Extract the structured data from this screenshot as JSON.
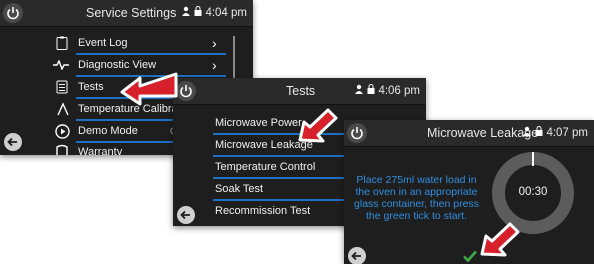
{
  "screen1": {
    "title": "Service Settings",
    "time": "4:04 pm",
    "items": [
      {
        "label": "Event Log",
        "icon": "clipboard-icon"
      },
      {
        "label": "Diagnostic View",
        "icon": "pulse-icon"
      },
      {
        "label": "Tests",
        "icon": "checklist-icon"
      },
      {
        "label": "Temperature Calibration",
        "icon": "flame-icon"
      },
      {
        "label": "Demo Mode",
        "icon": "play-icon",
        "value": "O"
      },
      {
        "label": "Warranty",
        "icon": "warranty-icon"
      }
    ]
  },
  "screen2": {
    "title": "Tests",
    "time": "4:06 pm",
    "items": [
      {
        "label": "Microwave Power"
      },
      {
        "label": "Microwave Leakage"
      },
      {
        "label": "Temperature Control"
      },
      {
        "label": "Soak Test"
      },
      {
        "label": "Recommission Test"
      }
    ]
  },
  "screen3": {
    "title": "Microwave Leakage",
    "time": "4:07 pm",
    "instruction": "Place 275ml water load in the oven in an appropriate glass container, then press the green tick to start.",
    "timer": "00:30",
    "timer_progress": 0.0
  },
  "colors": {
    "accent_blue": "#1f6fc4",
    "instruction_blue": "#2f8fe0",
    "callout_red": "#d8202a",
    "tick_green": "#3fae49"
  }
}
